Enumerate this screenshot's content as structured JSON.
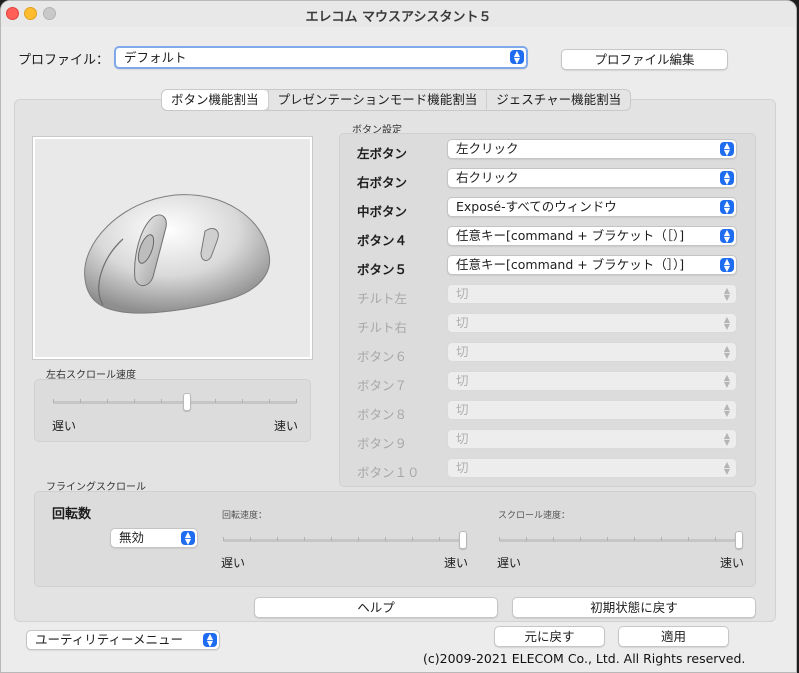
{
  "window": {
    "title": "エレコム マウスアシスタント５"
  },
  "profile": {
    "label": "プロファイル：",
    "value": "デフォルト",
    "edit_button": "プロファイル編集"
  },
  "tabs": [
    {
      "label": "ボタン機能割当",
      "active": true
    },
    {
      "label": "プレゼンテーションモード機能割当",
      "active": false
    },
    {
      "label": "ジェスチャー機能割当",
      "active": false
    }
  ],
  "button_settings": {
    "title": "ボタン設定",
    "rows": [
      {
        "label": "左ボタン",
        "value": "左クリック",
        "enabled": true
      },
      {
        "label": "右ボタン",
        "value": "右クリック",
        "enabled": true
      },
      {
        "label": "中ボタン",
        "value": "Exposé-すべてのウィンドウ",
        "enabled": true
      },
      {
        "label": "ボタン４",
        "value": "任意キー[command + ブラケット（［）]",
        "enabled": true
      },
      {
        "label": "ボタン５",
        "value": "任意キー[command + ブラケット（］）]",
        "enabled": true
      },
      {
        "label": "チルト左",
        "value": "切",
        "enabled": false
      },
      {
        "label": "チルト右",
        "value": "切",
        "enabled": false
      },
      {
        "label": "ボタン６",
        "value": "切",
        "enabled": false
      },
      {
        "label": "ボタン７",
        "value": "切",
        "enabled": false
      },
      {
        "label": "ボタン８",
        "value": "切",
        "enabled": false
      },
      {
        "label": "ボタン９",
        "value": "切",
        "enabled": false
      },
      {
        "label": "ボタン１０",
        "value": "切",
        "enabled": false
      }
    ]
  },
  "horizontal_scroll": {
    "title": "左右スクロール速度",
    "slow": "遅い",
    "fast": "速い",
    "value": 0.55
  },
  "flying_scroll": {
    "title": "フライングスクロール",
    "rotation_label": "回転数",
    "rotation_value": "無効",
    "rotation_speed": {
      "label": "回転速度：",
      "slow": "遅い",
      "fast": "速い",
      "value": 1.0
    },
    "scroll_speed": {
      "label": "スクロール速度：",
      "slow": "遅い",
      "fast": "速い",
      "value": 1.0
    }
  },
  "buttons": {
    "help": "ヘルプ",
    "reset": "初期状態に戻す",
    "revert": "元に戻す",
    "apply": "適用"
  },
  "utility_menu": "ユーティリティーメニュー",
  "copyright": "(c)2009-2021 ELECOM Co., Ltd. All Rights reserved.",
  "colors": {
    "accent": "#1e6cf0",
    "window_bg": "#ececec",
    "close": "#ff5f57",
    "minimize": "#febc2e"
  }
}
